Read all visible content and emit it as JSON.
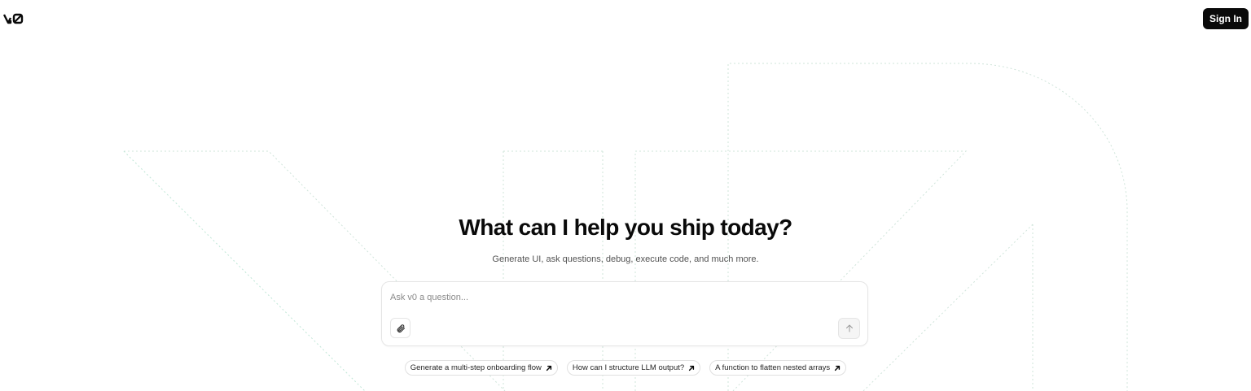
{
  "header": {
    "logo_icon": "v0-logo-icon",
    "sign_in_label": "Sign In"
  },
  "hero": {
    "title": "What can I help you ship today?",
    "subtitle": "Generate UI, ask questions, debug, execute code, and much more."
  },
  "prompt": {
    "placeholder": "Ask v0 a question...",
    "value": "",
    "attach_icon": "paperclip-icon",
    "send_icon": "arrow-up-icon"
  },
  "suggestions": [
    {
      "label": "Generate a multi-step onboarding flow",
      "icon": "arrow-up-right-icon"
    },
    {
      "label": "How can I structure LLM output?",
      "icon": "arrow-up-right-icon"
    },
    {
      "label": "A function to flatten nested arrays",
      "icon": "arrow-up-right-icon"
    }
  ],
  "colors": {
    "primary": "#0a0a0a",
    "background": "#ffffff",
    "border": "#e5e5e5",
    "muted_text": "#525252",
    "decor_line": "#cfe9dd"
  }
}
